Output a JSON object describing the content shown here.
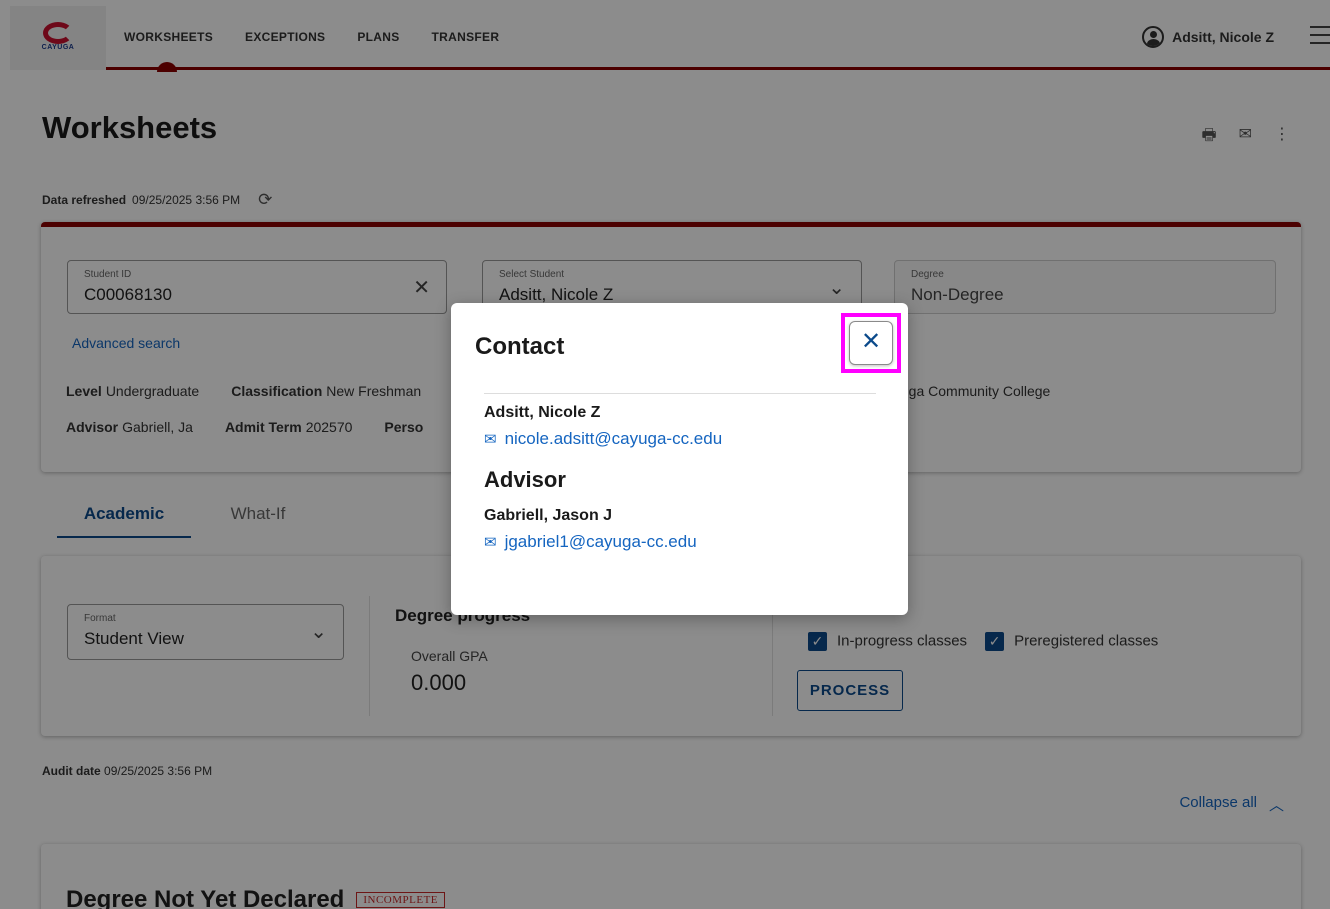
{
  "logo": {
    "text": "CAYUGA"
  },
  "nav": {
    "items": [
      "WORKSHEETS",
      "EXCEPTIONS",
      "PLANS",
      "TRANSFER"
    ]
  },
  "user": {
    "name": "Adsitt, Nicole Z"
  },
  "page": {
    "title": "Worksheets",
    "refresh_label": "Data refreshed",
    "refresh_value": "09/25/2025 3:56 PM"
  },
  "student_card": {
    "student_id_label": "Student ID",
    "student_id_value": "C00068130",
    "select_student_label": "Select Student",
    "select_student_value": "Adsitt, Nicole Z",
    "degree_label": "Degree",
    "degree_value": "Non-Degree",
    "advanced_search": "Advanced search",
    "level_label": "Level",
    "level_value": "Undergraduate",
    "classification_label": "Classification",
    "classification_value": "New Freshman",
    "college_value": "Cayuga Community College",
    "advisor_label": "Advisor",
    "advisor_value": "Gabriell, Ja",
    "admit_term_label": "Admit Term",
    "admit_term_value": "202570",
    "person_label": "Perso"
  },
  "tabs": [
    "Academic",
    "What-If"
  ],
  "audit_card": {
    "format_label": "Format",
    "format_value": "Student View",
    "progress_title": "Degree progress",
    "gpa_label": "Overall GPA",
    "gpa_value": "0.000",
    "inprogress_label": "In-progress classes",
    "preregistered_label": "Preregistered classes",
    "process_label": "PROCESS"
  },
  "audit_date": {
    "label": "Audit date",
    "value": "09/25/2025 3:56 PM"
  },
  "collapse_all": "Collapse all",
  "degree_block": {
    "title": "Degree Not Yet Declared",
    "badge": "INCOMPLETE"
  },
  "modal": {
    "title": "Contact",
    "close_glyph": "✕",
    "student_name": "Adsitt, Nicole Z",
    "student_email": "nicole.adsitt@cayuga-cc.edu",
    "advisor_heading": "Advisor",
    "advisor_name": "Gabriell, Jason J",
    "advisor_email": "jgabriel1@cayuga-cc.edu"
  },
  "colors": {
    "brand_red": "#8b0000",
    "link_blue": "#1565c0",
    "primary_blue": "#0b4a8b",
    "highlight": "#ff00ff"
  },
  "icons": [
    "user-circle-icon",
    "menu-icon",
    "print-icon",
    "mail-icon",
    "more-vert-icon",
    "refresh-icon",
    "close-icon",
    "chevron-down-icon",
    "chevron-up-icon",
    "check-icon"
  ]
}
